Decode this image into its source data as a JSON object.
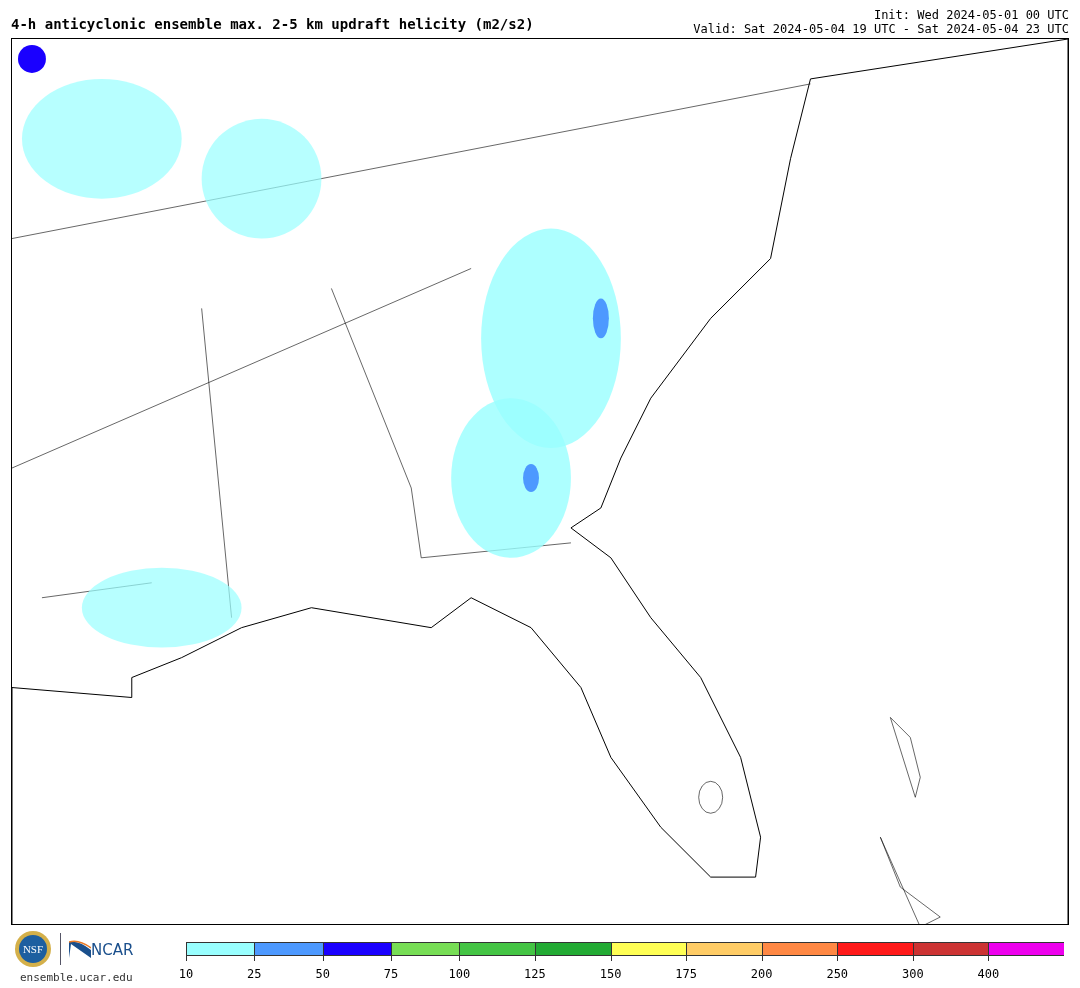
{
  "title": "4-h anticyclonic ensemble max. 2-5 km updraft helicity (m2/s2)",
  "init": "Init: Wed 2024-05-01 00 UTC",
  "valid": "Valid: Sat 2024-05-04 19 UTC - Sat 2024-05-04 23 UTC",
  "logos": {
    "nsf": "NSF",
    "ncar": "NCAR",
    "url": "ensemble.ucar.edu"
  },
  "colorbar": [
    {
      "label": "10",
      "color": "#99ffff"
    },
    {
      "label": "25",
      "color": "#4d99ff"
    },
    {
      "label": "50",
      "color": "#1a00ff"
    },
    {
      "label": "75",
      "color": "#77dd55"
    },
    {
      "label": "100",
      "color": "#44c444"
    },
    {
      "label": "125",
      "color": "#22aa33"
    },
    {
      "label": "150",
      "color": "#ffff55"
    },
    {
      "label": "175",
      "color": "#ffcc66"
    },
    {
      "label": "200",
      "color": "#ff8844"
    },
    {
      "label": "250",
      "color": "#ff1a1a"
    },
    {
      "label": "300",
      "color": "#cc3333"
    },
    {
      "label": "400",
      "color": "#ee00ee"
    }
  ]
}
